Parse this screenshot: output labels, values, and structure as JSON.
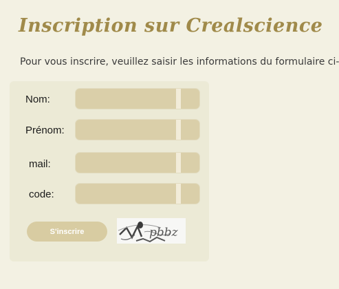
{
  "page": {
    "title": "Inscription sur Crealscience",
    "intro": "Pour vous inscrire, veuillez saisir les informations du formulaire ci-dessous"
  },
  "form": {
    "fields": [
      {
        "label": "Nom:",
        "value": ""
      },
      {
        "label": "Prénom:",
        "value": ""
      },
      {
        "label": "mail:",
        "value": ""
      },
      {
        "label": "code:",
        "value": ""
      }
    ],
    "submit_label": "S'inscrire",
    "captcha_text": "pbbz"
  },
  "colors": {
    "title": "#a08a4a",
    "background": "#f3f1e3",
    "input_fill": "#dacfa9",
    "button": "#d8cca2"
  }
}
